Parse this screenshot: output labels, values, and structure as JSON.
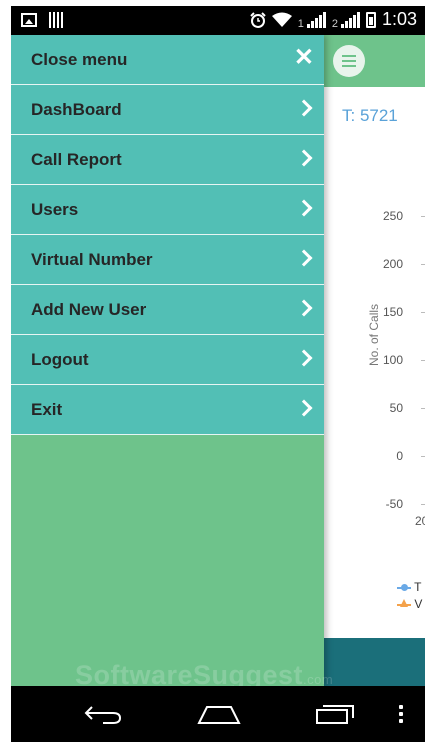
{
  "status_bar": {
    "sim1": "1",
    "sim2": "2",
    "time": "1:03"
  },
  "icons": {
    "gallery": "image-icon",
    "barcode": "barcode-icon",
    "alarm": "alarm-clock-icon",
    "wifi": "wifi-icon",
    "signal": "signal-icon",
    "battery": "battery-icon",
    "menu": "hamburger-menu-icon",
    "close": "close-icon",
    "chevron": "chevron-right-icon",
    "back": "back-icon",
    "home": "home-icon",
    "recents": "recent-apps-icon",
    "more": "more-vert-icon"
  },
  "drawer": {
    "items": [
      {
        "label": "Close menu"
      },
      {
        "label": "DashBoard"
      },
      {
        "label": "Call Report"
      },
      {
        "label": "Users"
      },
      {
        "label": "Virtual Number"
      },
      {
        "label": "Add New User"
      },
      {
        "label": "Logout"
      },
      {
        "label": "Exit"
      }
    ]
  },
  "background": {
    "total_label": "T: 5721",
    "chart_data": {
      "type": "line",
      "ylabel": "No. of Calls",
      "y_ticks": [
        "250",
        "200",
        "150",
        "100",
        "50",
        "0",
        "-50"
      ],
      "x_ticks": [
        "20"
      ],
      "legend": [
        "T",
        "V"
      ]
    }
  },
  "watermark": {
    "text": "SoftwareSuggest",
    "suffix": ".com"
  },
  "colors": {
    "drawer_item": "#52bfb5",
    "drawer_bg": "#6ec38b",
    "header": "#6ec38b",
    "footer": "#1b6f7a",
    "accent_text": "#5aa2d8"
  }
}
